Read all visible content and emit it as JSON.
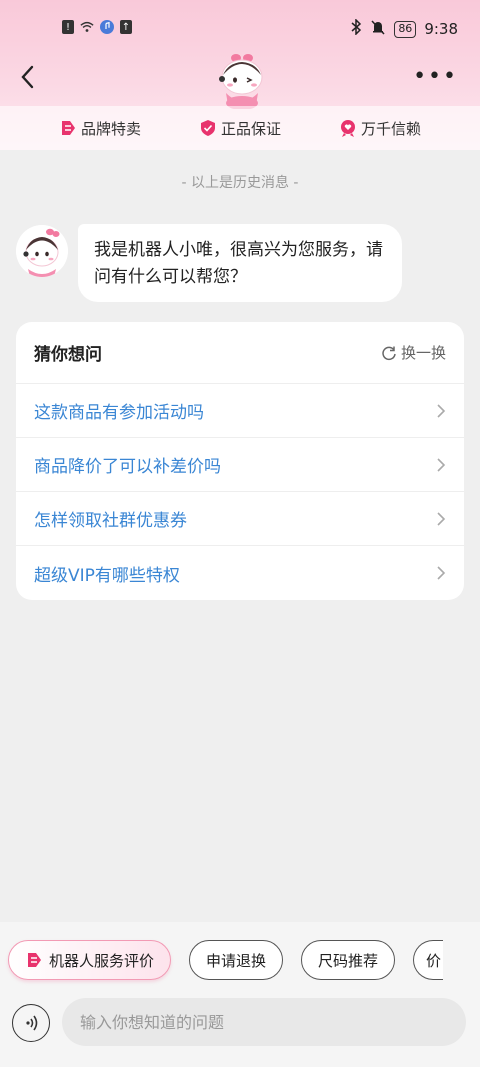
{
  "status": {
    "time": "9:38",
    "battery": "86"
  },
  "nav": {
    "more": "•••"
  },
  "guarantees": [
    {
      "label": "品牌特卖"
    },
    {
      "label": "正品保证"
    },
    {
      "label": "万千信赖"
    }
  ],
  "history_divider": "- 以上是历史消息 -",
  "bot_message": "我是机器人小唯，很高兴为您服务，请问有什么可以帮您？",
  "guess": {
    "title": "猜你想问",
    "refresh": "换一换",
    "questions": [
      "这款商品有参加活动吗",
      "商品降价了可以补差价吗",
      "怎样领取社群优惠券",
      "超级VIP有哪些特权"
    ]
  },
  "chips": {
    "rate": "机器人服务评价",
    "refund": "申请退换",
    "size": "尺码推荐",
    "partial": "价"
  },
  "input": {
    "placeholder": "输入你想知道的问题"
  },
  "colors": {
    "accent": "#e8336d",
    "link": "#3a86d4"
  }
}
